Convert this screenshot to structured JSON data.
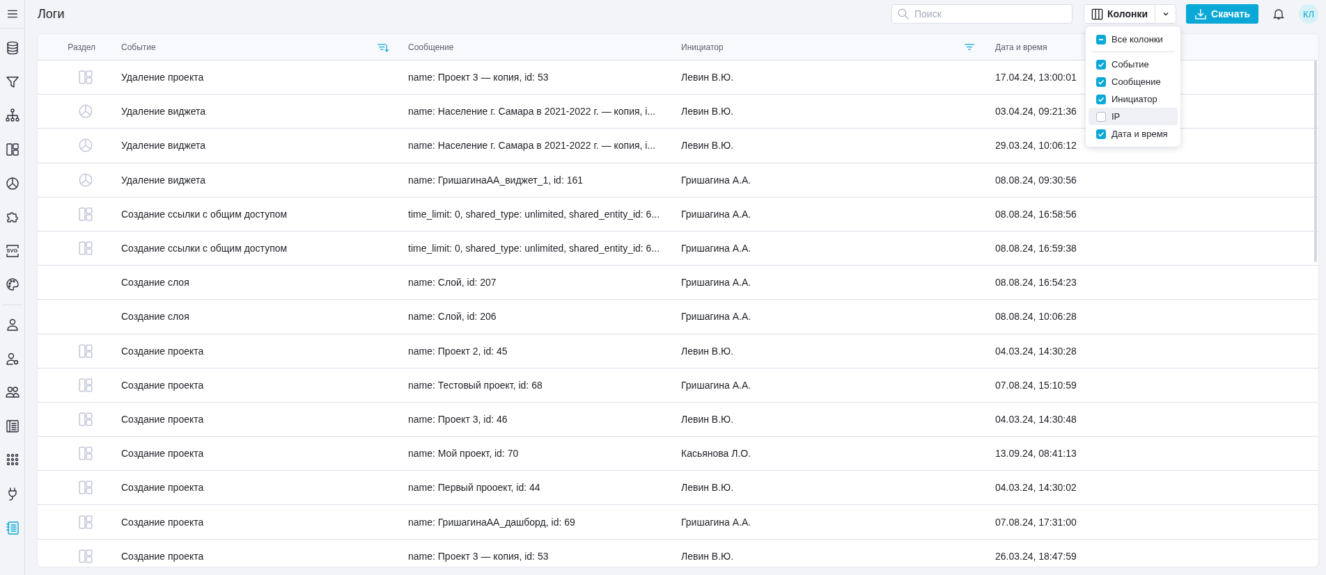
{
  "sidebar": {
    "items": [
      {
        "kind": "database",
        "selected": false
      },
      {
        "kind": "filter",
        "selected": false
      },
      {
        "kind": "hierarchy",
        "selected": false
      },
      {
        "kind": "dashboard",
        "selected": false
      },
      {
        "kind": "chart",
        "selected": false
      },
      {
        "kind": "puzzle",
        "selected": false
      },
      {
        "kind": "svg",
        "label": "SVG",
        "selected": false
      },
      {
        "kind": "palette",
        "selected": false
      },
      {
        "kind": "divider"
      },
      {
        "kind": "user",
        "selected": false
      },
      {
        "kind": "user-gear",
        "selected": false
      },
      {
        "kind": "users",
        "selected": false
      },
      {
        "kind": "book",
        "selected": false
      },
      {
        "kind": "grid",
        "selected": false
      },
      {
        "kind": "plug",
        "selected": false
      },
      {
        "kind": "logs",
        "selected": true
      }
    ]
  },
  "header": {
    "title": "Логи",
    "search": {
      "placeholder": "Поиск"
    },
    "columns_button": "Колонки",
    "download_button": "Скачать",
    "avatar": "КЛ"
  },
  "columns_menu": {
    "all": {
      "label": "Все колонки",
      "checked": true,
      "indeterminate": true
    },
    "items": [
      {
        "label": "Событие",
        "checked": true,
        "highlighted": false
      },
      {
        "label": "Сообщение",
        "checked": true,
        "highlighted": false
      },
      {
        "label": "Инициатор",
        "checked": true,
        "highlighted": false
      },
      {
        "label": "IP",
        "checked": false,
        "highlighted": true
      },
      {
        "label": "Дата и время",
        "checked": true,
        "highlighted": false
      }
    ]
  },
  "table": {
    "columns": [
      {
        "label": "Раздел",
        "kind": "plain"
      },
      {
        "label": "Событие",
        "kind": "sort-filter"
      },
      {
        "label": "Сообщение",
        "kind": "plain"
      },
      {
        "label": "Инициатор",
        "kind": "filter"
      },
      {
        "label": "Дата и время",
        "kind": "plain"
      }
    ],
    "rows": [
      {
        "kind": "dashboard",
        "event": "Удаление проекта",
        "message": "name: Проект 3 — копия, id: 53",
        "initiator": "Левин В.Ю.",
        "datetime": "17.04.24, 13:00:01"
      },
      {
        "kind": "chart",
        "event": "Удаление виджета",
        "message": "name: Население г. Самара в 2021-2022 г. — копия, i...",
        "initiator": "Левин В.Ю.",
        "datetime": "03.04.24, 09:21:36"
      },
      {
        "kind": "chart",
        "event": "Удаление виджета",
        "message": "name: Население г. Самара в 2021-2022 г. — копия, i...",
        "initiator": "Левин В.Ю.",
        "datetime": "29.03.24, 10:06:12"
      },
      {
        "kind": "chart",
        "event": "Удаление виджета",
        "message": "name: ГришагинаАА_виджет_1, id: 161",
        "initiator": "Гришагина А.А.",
        "datetime": "08.08.24, 09:30:56"
      },
      {
        "kind": "dashboard",
        "event": "Создание ссылки с общим доступом",
        "message": "time_limit: 0, shared_type: unlimited, shared_entity_id: 6...",
        "initiator": "Гришагина А.А.",
        "datetime": "08.08.24, 16:58:56"
      },
      {
        "kind": "dashboard",
        "event": "Создание ссылки с общим доступом",
        "message": "time_limit: 0, shared_type: unlimited, shared_entity_id: 6...",
        "initiator": "Гришагина А.А.",
        "datetime": "08.08.24, 16:59:38"
      },
      {
        "kind": "none",
        "event": "Создание слоя",
        "message": "name: Слой, id: 207",
        "initiator": "Гришагина А.А.",
        "datetime": "08.08.24, 16:54:23"
      },
      {
        "kind": "none",
        "event": "Создание слоя",
        "message": "name: Слой, id: 206",
        "initiator": "Гришагина А.А.",
        "datetime": "08.08.24, 10:06:28"
      },
      {
        "kind": "dashboard",
        "event": "Создание проекта",
        "message": "name: Проект 2, id: 45",
        "initiator": "Левин В.Ю.",
        "datetime": "04.03.24, 14:30:28"
      },
      {
        "kind": "dashboard",
        "event": "Создание проекта",
        "message": "name: Тестовый проект, id: 68",
        "initiator": "Гришагина А.А.",
        "datetime": "07.08.24, 15:10:59"
      },
      {
        "kind": "dashboard",
        "event": "Создание проекта",
        "message": "name: Проект 3, id: 46",
        "initiator": "Левин В.Ю.",
        "datetime": "04.03.24, 14:30:48"
      },
      {
        "kind": "dashboard",
        "event": "Создание проекта",
        "message": "name: Мой проект, id: 70",
        "initiator": "Касьянова Л.О.",
        "datetime": "13.09.24, 08:41:13"
      },
      {
        "kind": "dashboard",
        "event": "Создание проекта",
        "message": "name: Первый прооект, id: 44",
        "initiator": "Левин В.Ю.",
        "datetime": "04.03.24, 14:30:02"
      },
      {
        "kind": "dashboard",
        "event": "Создание проекта",
        "message": "name: ГришагинаАА_дашборд, id: 69",
        "initiator": "Гришагина А.А.",
        "datetime": "07.08.24, 17:31:00"
      },
      {
        "kind": "dashboard",
        "event": "Создание проекта",
        "message": "name: Проект 3 — копия, id: 53",
        "initiator": "Левин В.Ю.",
        "datetime": "26.03.24, 18:47:59"
      }
    ]
  }
}
